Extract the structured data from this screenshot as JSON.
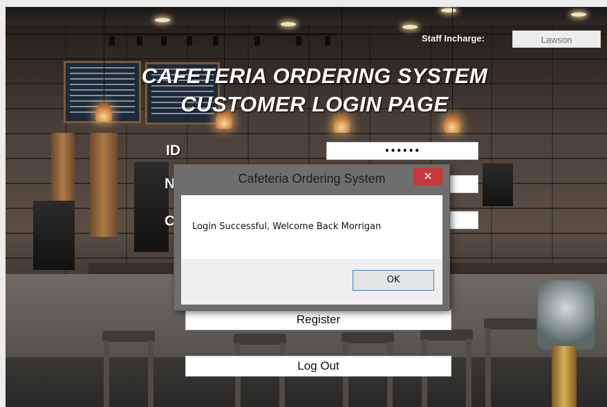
{
  "header": {
    "title_line1": "CAFETERIA ORDERING SYSTEM",
    "title_line2": "CUSTOMER LOGIN PAGE",
    "staff_label": "Staff Incharge:",
    "staff_value": "Lawson"
  },
  "form": {
    "id_label": "ID",
    "n_label_partial": "N",
    "c_label_partial": "C",
    "password_mask": "••••••"
  },
  "buttons": {
    "register": "Register",
    "logout": "Log Out"
  },
  "dialog": {
    "title": "Cafeteria Ordering System",
    "close": "✕",
    "message": "Login Successful, Welcome Back Morrigan",
    "ok": "OK"
  },
  "colors": {
    "close_red": "#c7383a",
    "ok_border": "#3c7fd1"
  }
}
